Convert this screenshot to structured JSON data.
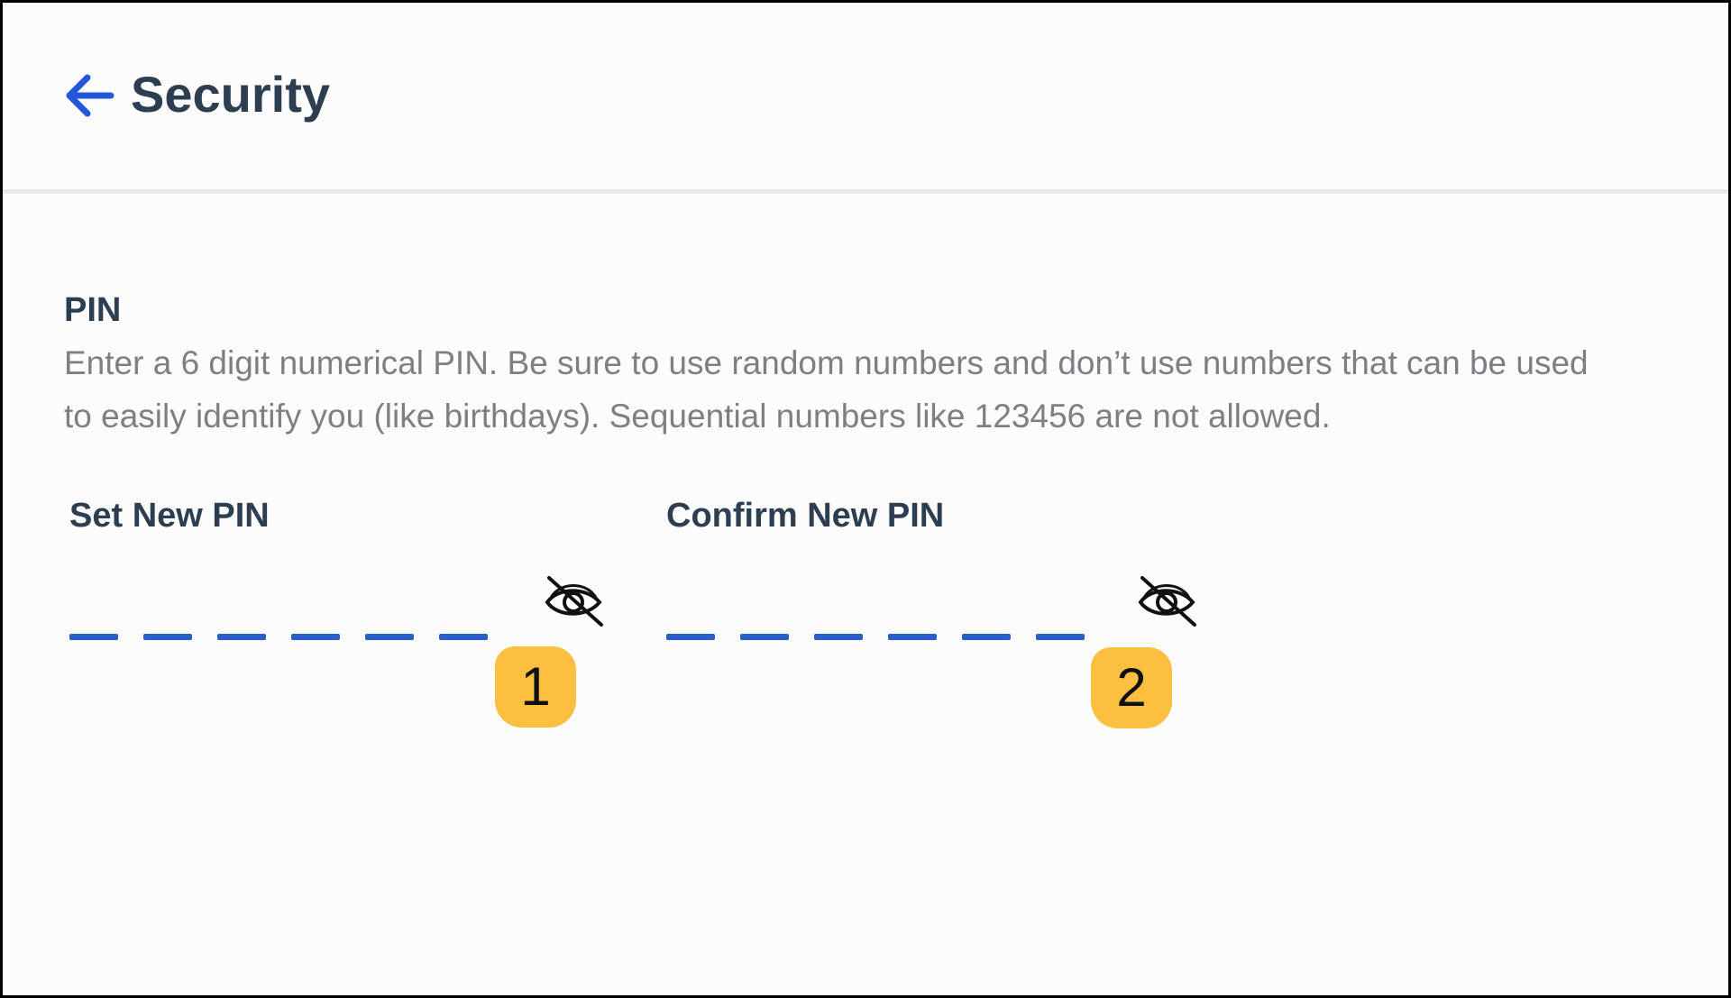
{
  "header": {
    "title": "Security",
    "back_icon": "arrow-left-icon",
    "accent_color": "#2356d9"
  },
  "pin_section": {
    "title": "PIN",
    "description": "Enter a 6 digit numerical PIN. Be sure to use random numbers and don’t use numbers that can be used to easily identify you (like birthdays). Sequential numbers like 123456 are not allowed."
  },
  "set_pin": {
    "label": "Set New PIN",
    "digit_count": 6,
    "value": "",
    "visibility_icon": "eye-slash-icon"
  },
  "confirm_pin": {
    "label": "Confirm New PIN",
    "digit_count": 6,
    "value": "",
    "visibility_icon": "eye-slash-icon"
  },
  "callouts": [
    {
      "label": "1",
      "color": "#fcc040"
    },
    {
      "label": "2",
      "color": "#fcc040"
    }
  ]
}
